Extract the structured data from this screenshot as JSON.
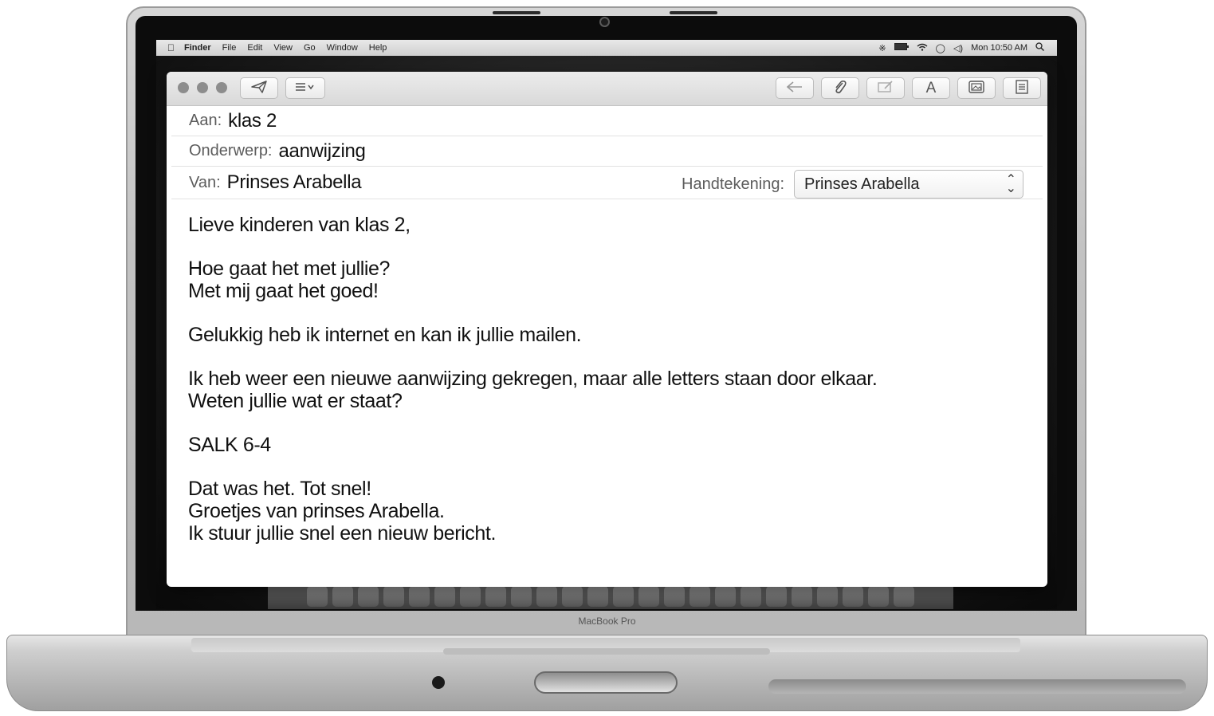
{
  "menubar": {
    "items": [
      "Finder",
      "File",
      "Edit",
      "View",
      "Go",
      "Window",
      "Help"
    ],
    "clock": "Mon 10:50 AM"
  },
  "laptop": {
    "model_label": "MacBook Pro"
  },
  "compose": {
    "to_label": "Aan:",
    "to_value": "klas 2",
    "subject_label": "Onderwerp:",
    "subject_value": "aanwijzing",
    "from_label": "Van:",
    "from_value": "Prinses Arabella",
    "signature_label": "Handtekening:",
    "signature_value": "Prinses Arabella"
  },
  "body": {
    "greeting": "Lieve kinderen van klas 2,",
    "p1_l1": "Hoe gaat het met jullie?",
    "p1_l2": "Met mij gaat het goed!",
    "p2_l1": "Gelukkig heb ik internet en kan ik jullie mailen.",
    "p3_l1": "Ik heb weer een nieuwe aanwijzing gekregen, maar alle letters staan door elkaar.",
    "p3_l2": "Weten jullie wat er staat?",
    "code": "SALK 6-4",
    "p5_l1": "Dat was het. Tot snel!",
    "p5_l2": "Groetjes van prinses Arabella.",
    "p5_l3": "Ik stuur jullie snel een nieuw bericht."
  },
  "icons": {
    "send": "send-icon",
    "format_list": "list-format-icon",
    "reply": "reply-icon",
    "attach": "paperclip-icon",
    "markup": "markup-icon",
    "fonts": "font-icon",
    "photo": "photo-browser-icon",
    "template": "stationery-icon"
  }
}
